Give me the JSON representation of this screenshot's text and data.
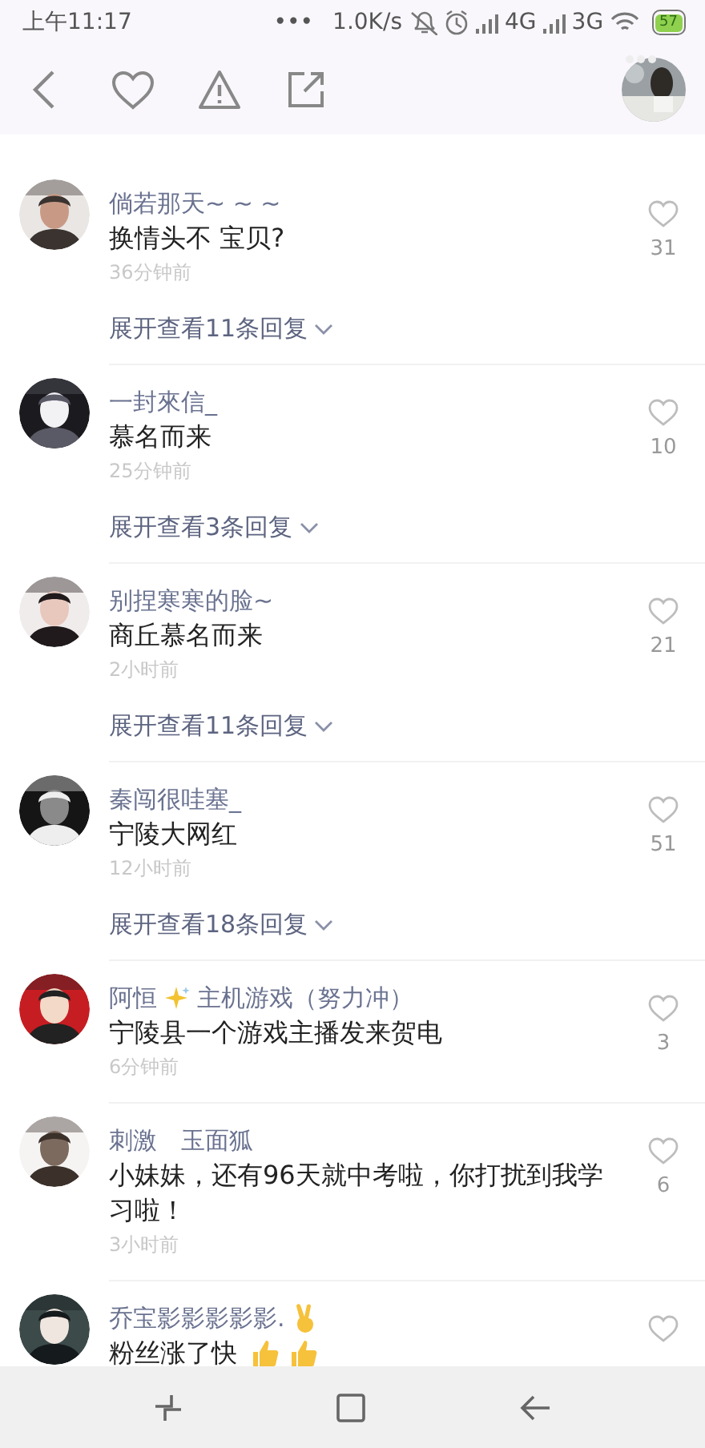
{
  "status_bar": {
    "time": "上午11:17",
    "more": "•••",
    "speed": "1.0K/s",
    "network_1": "4G",
    "network_2": "3G",
    "battery": "57"
  },
  "comments": [
    {
      "name": "倘若那天~ ~ ~",
      "text": "换情头不 宝贝?",
      "time": "36分钟前",
      "likes": "31",
      "replies": "展开查看11条回复"
    },
    {
      "name": "一封來信_",
      "text": "慕名而来",
      "time": "25分钟前",
      "likes": "10",
      "replies": "展开查看3条回复"
    },
    {
      "name": "别捏寒寒的脸~",
      "text": "商丘慕名而来",
      "time": "2小时前",
      "likes": "21",
      "replies": "展开查看11条回复"
    },
    {
      "name": "秦闯很哇塞_",
      "text": "宁陵大网红",
      "time": "12小时前",
      "likes": "51",
      "replies": "展开查看18条回复"
    },
    {
      "name": "阿恒",
      "name_icons": [
        {
          "kind": "sparkle"
        }
      ],
      "tag": "主机游戏（努力冲）",
      "text": "宁陵县一个游戏主播发来贺电",
      "time": "6分钟前",
      "likes": "3"
    },
    {
      "name": "刺激　玉面狐",
      "text": "小妹妹，还有96天就中考啦，你打扰到我学习啦！",
      "time": "3小时前",
      "likes": "6"
    },
    {
      "name": "乔宝影影影影影.",
      "name_icons": [
        {
          "kind": "victory"
        }
      ],
      "text": "粉丝涨了快",
      "text_icons": [
        {
          "kind": "thumbs-up"
        },
        {
          "kind": "thumbs-up"
        }
      ]
    }
  ]
}
